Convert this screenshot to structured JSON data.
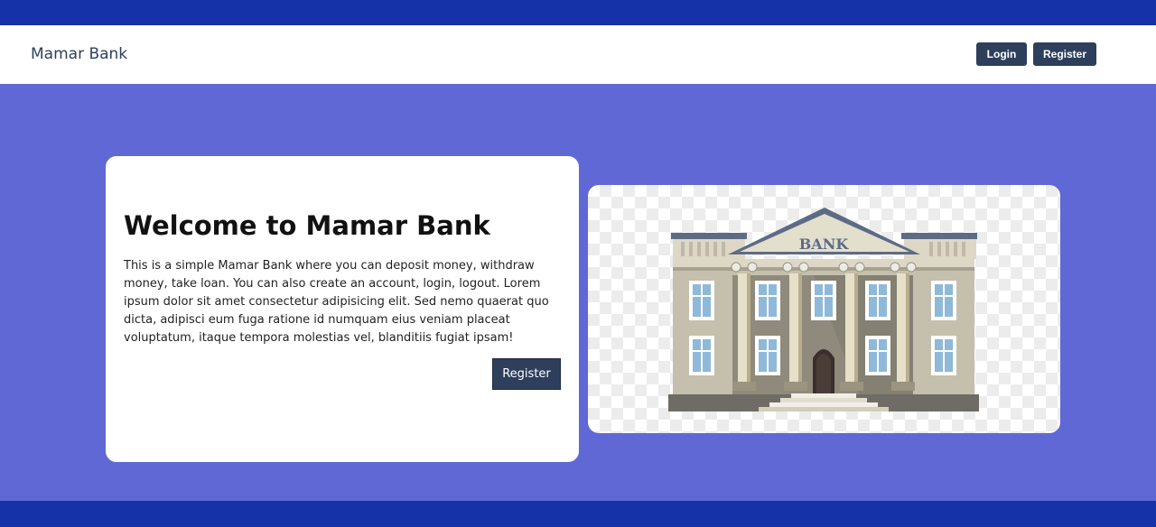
{
  "navbar": {
    "brand": "Mamar Bank",
    "login_label": "Login",
    "register_label": "Register"
  },
  "hero": {
    "title": "Welcome to Mamar Bank",
    "description": "This is a simple Mamar Bank where you can deposit money, withdraw money, take loan. You can also create an account, login, logout. Lorem ipsum dolor sit amet consectetur adipisicing elit. Sed nemo quaerat quo dicta, adipisci eum fuga ratione id numquam eius veniam placeat voluptatum, itaque tempora molestias vel, blanditiis fugiat ipsam!",
    "register_label": "Register"
  },
  "illustration": {
    "icon": "bank-building-illustration",
    "sign_text": "BANK"
  },
  "colors": {
    "page_background": "#5f68d4",
    "strip": "#1632a8",
    "primary_button": "#2e3f5c",
    "card": "#ffffff"
  }
}
